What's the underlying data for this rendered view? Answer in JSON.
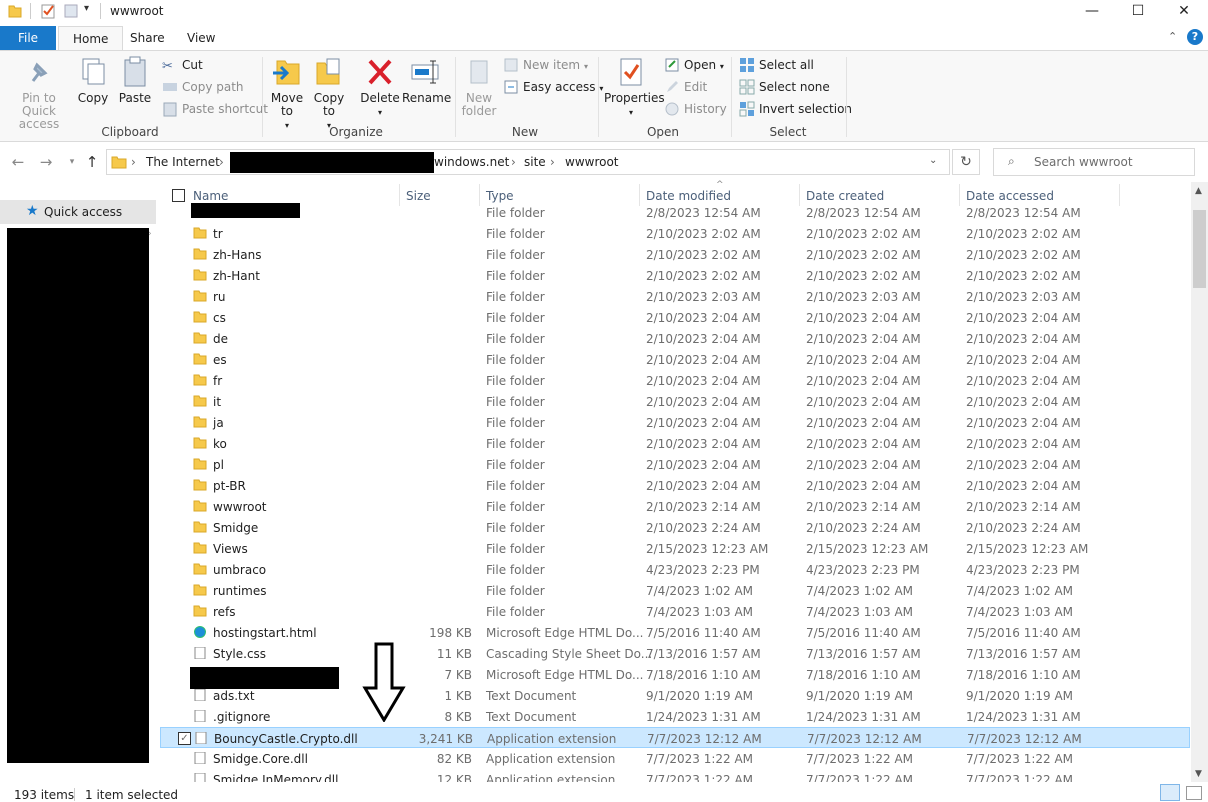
{
  "window": {
    "title": "wwwroot",
    "minimize": "—",
    "maximize": "☐",
    "close": "✕"
  },
  "ribbon_tabs": [
    "File",
    "Home",
    "Share",
    "View"
  ],
  "ribbon": {
    "clipboard": {
      "pin_to_quick_access": "Pin to Quick access",
      "copy": "Copy",
      "paste": "Paste",
      "cut": "Cut",
      "copy_path": "Copy path",
      "paste_shortcut": "Paste shortcut",
      "label": "Clipboard"
    },
    "organize": {
      "move_to": "Move to",
      "copy_to": "Copy to",
      "delete": "Delete",
      "rename": "Rename",
      "label": "Organize"
    },
    "new": {
      "new_folder": "New folder",
      "new_item": "New item",
      "easy_access": "Easy access",
      "label": "New"
    },
    "open": {
      "properties": "Properties",
      "open": "Open",
      "edit": "Edit",
      "history": "History",
      "label": "Open"
    },
    "select": {
      "select_all": "Select all",
      "select_none": "Select none",
      "invert_selection": "Invert selection",
      "label": "Select"
    }
  },
  "address": {
    "crumb_root": "The Internet",
    "crumb_host": "windows.net",
    "crumb_site": "site",
    "crumb_wwwroot": "wwwroot",
    "search_placeholder": "Search wwwroot"
  },
  "navpane": {
    "quick_access": "Quick access"
  },
  "columns": {
    "name": "Name",
    "size": "Size",
    "type": "Type",
    "date_modified": "Date modified",
    "date_created": "Date created",
    "date_accessed": "Date accessed"
  },
  "files": [
    {
      "name": "",
      "size": "",
      "type": "File folder",
      "dm": "2/8/2023 12:54 AM",
      "dc": "2/8/2023 12:54 AM",
      "da": "2/8/2023 12:54 AM",
      "icon": "folder-icon"
    },
    {
      "name": "tr",
      "size": "",
      "type": "File folder",
      "dm": "2/10/2023 2:02 AM",
      "dc": "2/10/2023 2:02 AM",
      "da": "2/10/2023 2:02 AM",
      "icon": "folder-icon"
    },
    {
      "name": "zh-Hans",
      "size": "",
      "type": "File folder",
      "dm": "2/10/2023 2:02 AM",
      "dc": "2/10/2023 2:02 AM",
      "da": "2/10/2023 2:02 AM",
      "icon": "folder-icon"
    },
    {
      "name": "zh-Hant",
      "size": "",
      "type": "File folder",
      "dm": "2/10/2023 2:02 AM",
      "dc": "2/10/2023 2:02 AM",
      "da": "2/10/2023 2:02 AM",
      "icon": "folder-icon"
    },
    {
      "name": "ru",
      "size": "",
      "type": "File folder",
      "dm": "2/10/2023 2:03 AM",
      "dc": "2/10/2023 2:03 AM",
      "da": "2/10/2023 2:03 AM",
      "icon": "folder-icon"
    },
    {
      "name": "cs",
      "size": "",
      "type": "File folder",
      "dm": "2/10/2023 2:04 AM",
      "dc": "2/10/2023 2:04 AM",
      "da": "2/10/2023 2:04 AM",
      "icon": "folder-icon"
    },
    {
      "name": "de",
      "size": "",
      "type": "File folder",
      "dm": "2/10/2023 2:04 AM",
      "dc": "2/10/2023 2:04 AM",
      "da": "2/10/2023 2:04 AM",
      "icon": "folder-icon"
    },
    {
      "name": "es",
      "size": "",
      "type": "File folder",
      "dm": "2/10/2023 2:04 AM",
      "dc": "2/10/2023 2:04 AM",
      "da": "2/10/2023 2:04 AM",
      "icon": "folder-icon"
    },
    {
      "name": "fr",
      "size": "",
      "type": "File folder",
      "dm": "2/10/2023 2:04 AM",
      "dc": "2/10/2023 2:04 AM",
      "da": "2/10/2023 2:04 AM",
      "icon": "folder-icon"
    },
    {
      "name": "it",
      "size": "",
      "type": "File folder",
      "dm": "2/10/2023 2:04 AM",
      "dc": "2/10/2023 2:04 AM",
      "da": "2/10/2023 2:04 AM",
      "icon": "folder-icon"
    },
    {
      "name": "ja",
      "size": "",
      "type": "File folder",
      "dm": "2/10/2023 2:04 AM",
      "dc": "2/10/2023 2:04 AM",
      "da": "2/10/2023 2:04 AM",
      "icon": "folder-icon"
    },
    {
      "name": "ko",
      "size": "",
      "type": "File folder",
      "dm": "2/10/2023 2:04 AM",
      "dc": "2/10/2023 2:04 AM",
      "da": "2/10/2023 2:04 AM",
      "icon": "folder-icon"
    },
    {
      "name": "pl",
      "size": "",
      "type": "File folder",
      "dm": "2/10/2023 2:04 AM",
      "dc": "2/10/2023 2:04 AM",
      "da": "2/10/2023 2:04 AM",
      "icon": "folder-icon"
    },
    {
      "name": "pt-BR",
      "size": "",
      "type": "File folder",
      "dm": "2/10/2023 2:04 AM",
      "dc": "2/10/2023 2:04 AM",
      "da": "2/10/2023 2:04 AM",
      "icon": "folder-icon"
    },
    {
      "name": "wwwroot",
      "size": "",
      "type": "File folder",
      "dm": "2/10/2023 2:14 AM",
      "dc": "2/10/2023 2:14 AM",
      "da": "2/10/2023 2:14 AM",
      "icon": "folder-icon"
    },
    {
      "name": "Smidge",
      "size": "",
      "type": "File folder",
      "dm": "2/10/2023 2:24 AM",
      "dc": "2/10/2023 2:24 AM",
      "da": "2/10/2023 2:24 AM",
      "icon": "folder-icon"
    },
    {
      "name": "Views",
      "size": "",
      "type": "File folder",
      "dm": "2/15/2023 12:23 AM",
      "dc": "2/15/2023 12:23 AM",
      "da": "2/15/2023 12:23 AM",
      "icon": "folder-icon"
    },
    {
      "name": "umbraco",
      "size": "",
      "type": "File folder",
      "dm": "4/23/2023 2:23 PM",
      "dc": "4/23/2023 2:23 PM",
      "da": "4/23/2023 2:23 PM",
      "icon": "folder-icon"
    },
    {
      "name": "runtimes",
      "size": "",
      "type": "File folder",
      "dm": "7/4/2023 1:02 AM",
      "dc": "7/4/2023 1:02 AM",
      "da": "7/4/2023 1:02 AM",
      "icon": "folder-icon"
    },
    {
      "name": "refs",
      "size": "",
      "type": "File folder",
      "dm": "7/4/2023 1:03 AM",
      "dc": "7/4/2023 1:03 AM",
      "da": "7/4/2023 1:03 AM",
      "icon": "folder-icon"
    },
    {
      "name": "hostingstart.html",
      "size": "198 KB",
      "type": "Microsoft Edge HTML Do...",
      "dm": "7/5/2016 11:40 AM",
      "dc": "7/5/2016 11:40 AM",
      "da": "7/5/2016 11:40 AM",
      "icon": "edge-icon"
    },
    {
      "name": "Style.css",
      "size": "11 KB",
      "type": "Cascading Style Sheet Do...",
      "dm": "7/13/2016 1:57 AM",
      "dc": "7/13/2016 1:57 AM",
      "da": "7/13/2016 1:57 AM",
      "icon": "css-file-icon"
    },
    {
      "name": "",
      "size": "7 KB",
      "type": "Microsoft Edge HTML Do...",
      "dm": "7/18/2016 1:10 AM",
      "dc": "7/18/2016 1:10 AM",
      "da": "7/18/2016 1:10 AM",
      "icon": "edge-icon"
    },
    {
      "name": "ads.txt",
      "size": "1 KB",
      "type": "Text Document",
      "dm": "9/1/2020 1:19 AM",
      "dc": "9/1/2020 1:19 AM",
      "da": "9/1/2020 1:19 AM",
      "icon": "text-file-icon"
    },
    {
      "name": ".gitignore",
      "size": "8 KB",
      "type": "Text Document",
      "dm": "1/24/2023 1:31 AM",
      "dc": "1/24/2023 1:31 AM",
      "da": "1/24/2023 1:31 AM",
      "icon": "text-file-icon"
    },
    {
      "name": "BouncyCastle.Crypto.dll",
      "size": "3,241 KB",
      "type": "Application extension",
      "dm": "7/7/2023 12:12 AM",
      "dc": "7/7/2023 12:12 AM",
      "da": "7/7/2023 12:12 AM",
      "icon": "dll-file-icon",
      "selected": true
    },
    {
      "name": "Smidge.Core.dll",
      "size": "82 KB",
      "type": "Application extension",
      "dm": "7/7/2023 1:22 AM",
      "dc": "7/7/2023 1:22 AM",
      "da": "7/7/2023 1:22 AM",
      "icon": "dll-file-icon"
    },
    {
      "name": "Smidge.InMemory.dll",
      "size": "12 KB",
      "type": "Application extension",
      "dm": "7/7/2023 1:22 AM",
      "dc": "7/7/2023 1:22 AM",
      "da": "7/7/2023 1:22 AM",
      "icon": "dll-file-icon"
    }
  ],
  "status": {
    "item_count": "193 items",
    "selection": "1 item selected"
  },
  "colors": {
    "file_tab": "#1979ca",
    "selection_bg": "#cce8ff",
    "selection_border": "#99d1ff",
    "folder": "#f6c94b",
    "delete_red": "#d9202b"
  }
}
